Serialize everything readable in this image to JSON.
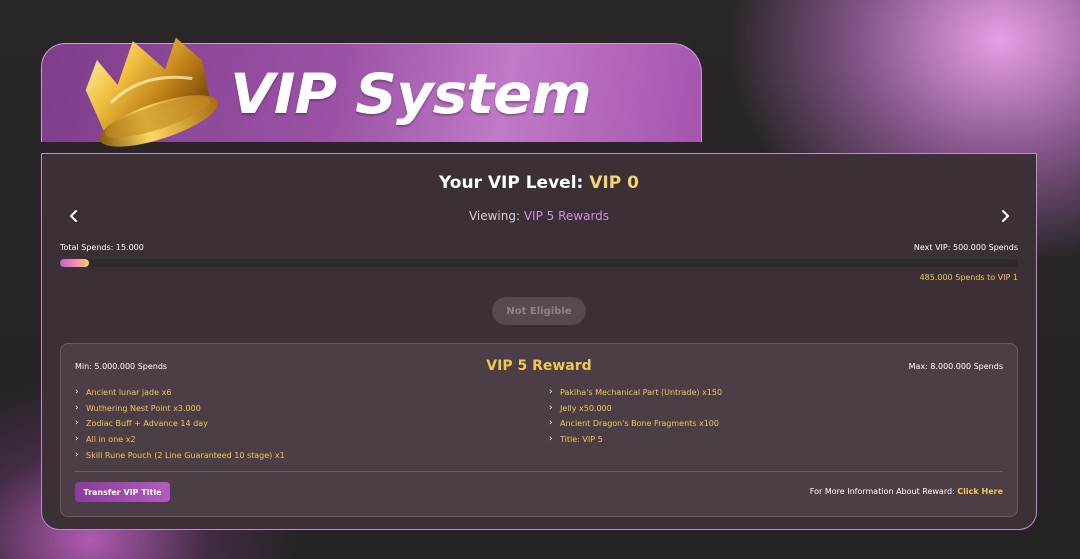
{
  "banner": {
    "title": "VIP System",
    "crown_icon": "crown-icon"
  },
  "vip": {
    "level_label": "Your VIP Level:",
    "level_value": "VIP 0",
    "viewing_label": "Viewing:",
    "viewing_value": "VIP 5 Rewards"
  },
  "progress": {
    "total_spends": "Total Spends: 15.000",
    "next_vip": "Next VIP: 500.000 Spends",
    "remaining": "485.000 Spends to VIP 1",
    "fill_fraction": 0.03
  },
  "claim_button": {
    "label": "Not Eligible"
  },
  "reward": {
    "min": "Min: 5.000.000 Spends",
    "title": "VIP 5 Reward",
    "max": "Max: 8.000.000 Spends",
    "left_items": [
      "Ancient lunar jade x6",
      "Wuthering Nest Point x3.000",
      "Zodiac Buff + Advance 14 day",
      "All in one x2",
      "Skill Rune Pouch (2 Line Guaranteed 10 stage) x1"
    ],
    "right_items": [
      "Pakiha's Mechanical Part (Untrade) x150",
      "Jelly x50.000",
      "Ancient Dragon's Bone Fragments x100",
      "Title: VIP 5"
    ],
    "transfer_label": "Transfer VIP Title",
    "more_info_label": "For More Information About Reward:",
    "more_info_link": "Click Here"
  },
  "colors": {
    "accent_gold": "#f2c74f",
    "accent_purple": "#d28ee0",
    "panel_bg": "#3a3036"
  }
}
